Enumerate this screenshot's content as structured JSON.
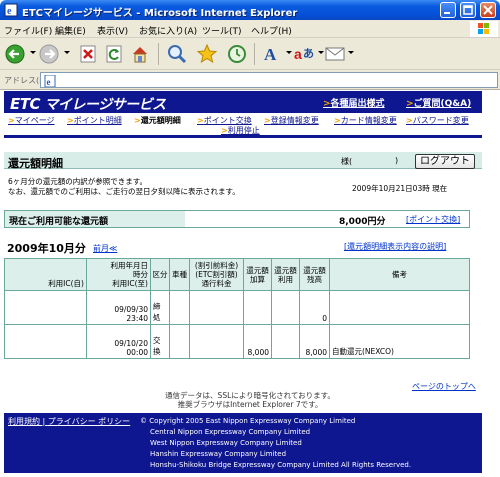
{
  "window": {
    "title": "ETCマイレージサービス - Microsoft Internet Explorer"
  },
  "menu": [
    "ファイル(F)",
    "編集(E)",
    "表示(V)",
    "お気に入り(A)",
    "ツール(T)",
    "ヘルプ(H)"
  ],
  "address": {
    "label": "アドレス(D)",
    "value": ""
  },
  "site": {
    "logo_etc": "ETC",
    "logo_text": "マイレージサービス",
    "header_links": [
      "各種届出様式",
      "ご質問(Q&A)"
    ],
    "nav_row1": [
      "マイページ",
      "ポイント明細",
      "還元額明細",
      "ポイント交換",
      "登録情報変更",
      "カード情報変更",
      "パスワード変更"
    ],
    "nav_row2": [
      "利用停止"
    ]
  },
  "section": {
    "title": "還元額明細",
    "sama": "様(",
    "sama_close": ")",
    "logout": "ログアウト",
    "notice_line1": "6ヶ月分の還元額の内訳が参照できます。",
    "notice_line2": "なお、還元額でのご利用は、ご走行の翌日夕刻以降に表示されます。",
    "datetime": "2009年10月21日03時 現在"
  },
  "balance": {
    "label": "現在ご利用可能な還元額",
    "amount": "8,000円分",
    "link": "[ポイント交換]"
  },
  "month": {
    "label": "2009年10月分",
    "prev": "前月≪",
    "how": "[還元額明細表示内容の説明]"
  },
  "table": {
    "headers": {
      "route": "利用IC(自)",
      "datetime_line1": "利用年月日",
      "datetime_line2": "時分",
      "datetime_line3": "利用IC(至)",
      "kubun": "区分",
      "car": "車種",
      "fare_line1": "(割引前料金)",
      "fare_line2": "(ETC割引額)",
      "fare_line3": "通行料金",
      "add_line1": "還元額",
      "add_line2": "加算",
      "use_line1": "還元額",
      "use_line2": "利用",
      "bal_line1": "還元額",
      "bal_line2": "残高",
      "note": "備考"
    },
    "rows": [
      {
        "date": "09/09/30",
        "time": "23:40",
        "kubun": "締処",
        "car": "",
        "fare": "",
        "add": "",
        "use": "",
        "bal": "0",
        "note": ""
      },
      {
        "date": "09/10/20",
        "time": "00:00",
        "kubun": "交換",
        "car": "",
        "fare": "",
        "add": "8,000",
        "use": "",
        "bal": "8,000",
        "note": "自動還元(NEXCO)"
      }
    ]
  },
  "pagetop": "ページのトップへ",
  "ssl_line1": "通信データは、SSLにより暗号化されております。",
  "ssl_line2": "推奨ブラウザはInternet Explorer 7です。",
  "footer": {
    "terms": "利用規約",
    "sep": "|",
    "privacy": "プライバシー ポリシー",
    "copyright": [
      "© Copyright 2005 East Nippon Expressway Company Limited",
      "Central Nippon Expressway Company Limited",
      "West Nippon Expressway Company Limited",
      "Hanshin Expressway Company Limited",
      "Honshu-Shikoku Bridge Expressway Company Limited All Rights Reserved."
    ]
  }
}
